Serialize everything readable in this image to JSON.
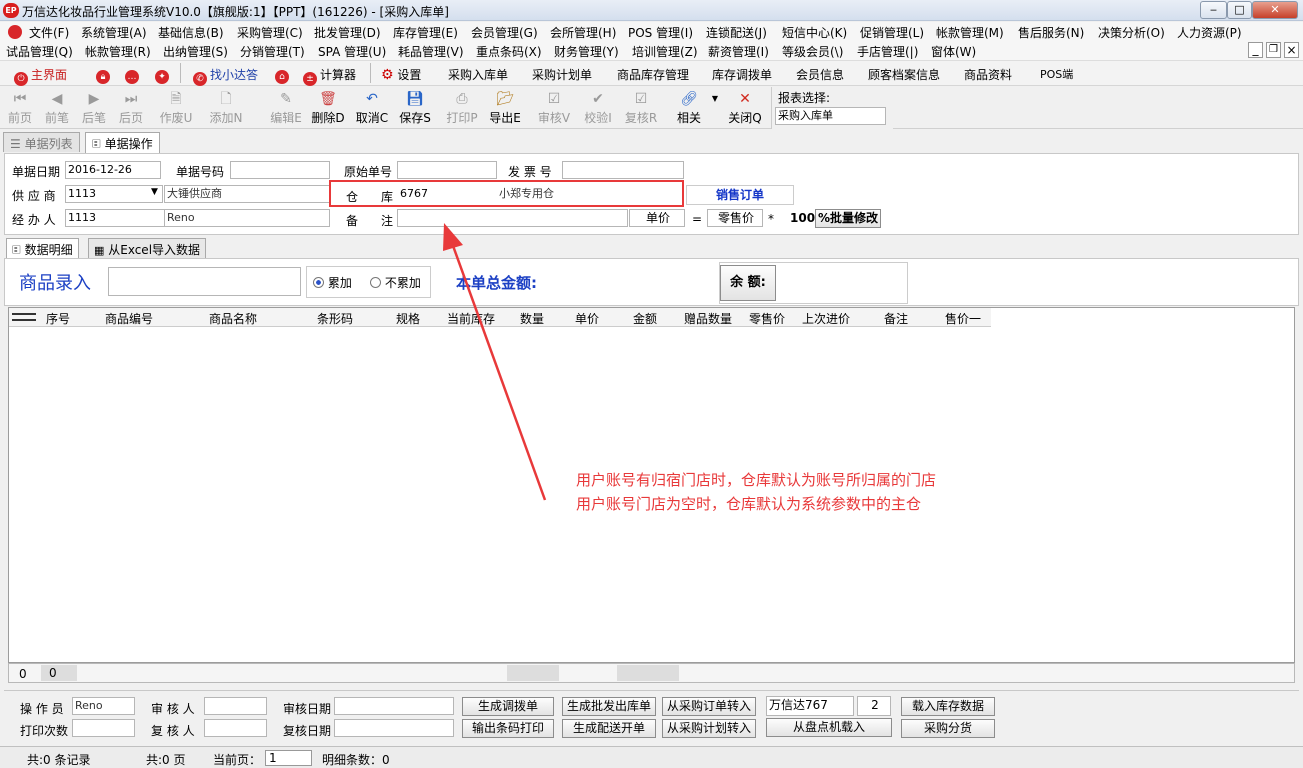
{
  "window": {
    "logo_text": "EP",
    "title": "万信达化妆品行业管理系统V10.0【旗舰版:1】【PPT】(161226) - [采购入库单]",
    "min": "‒",
    "max": "□",
    "close": "✕",
    "child_min": "_",
    "child_restore": "❐",
    "child_close": "×"
  },
  "menu_row1": [
    "文件(F)",
    "系统管理(A)",
    "基础信息(B)",
    "采购管理(C)",
    "批发管理(D)",
    "库存管理(E)",
    "会员管理(G)",
    "会所管理(H)",
    "POS 管理(I)",
    "连锁配送(J)",
    "短信中心(K)",
    "促销管理(L)",
    "帐款管理(M)",
    "售后服务(N)",
    "决策分析(O)",
    "人力资源(P)"
  ],
  "menu_row2": [
    "试品管理(Q)",
    "帐款管理(R)",
    "出纳管理(S)",
    "分销管理(T)",
    "SPA 管理(U)",
    "耗品管理(V)",
    "重点条码(X)",
    "财务管理(Y)",
    "培训管理(Z)",
    "薪资管理(I)",
    "等级会员(\\)",
    "手店管理(|)",
    "窗体(W)"
  ],
  "quickbar": {
    "home": "主界面",
    "find_helper": "找小达答",
    "calculator": "计算器",
    "settings": "设置",
    "links": [
      "采购入库单",
      "采购计划单",
      "商品库存管理",
      "库存调拨单",
      "会员信息",
      "顾客档案信息",
      "商品资料",
      "POS端"
    ]
  },
  "toolbar": {
    "buttons": [
      "前页",
      "前笔",
      "后笔",
      "后页",
      "作废U",
      "添加N",
      "编辑E",
      "删除D",
      "取消C",
      "保存S",
      "打印P",
      "导出E",
      "审核V",
      "校验I",
      "复核R",
      "相关",
      "关闭Q"
    ],
    "report_label": "报表选择:",
    "report_value": "采购入库单"
  },
  "tabs": {
    "list": "单据列表",
    "operate": "单据操作"
  },
  "form": {
    "date_label": "单据日期",
    "date_value": "2016-12-26",
    "docno_label": "单据号码",
    "docno_value": "",
    "orig_label": "原始单号",
    "orig_value": "",
    "invoice_label": "发 票 号",
    "invoice_value": "",
    "supplier_label": "供 应 商",
    "supplier_code": "1113",
    "supplier_name": "大锤供应商",
    "warehouse_label_1": "仓",
    "warehouse_label_2": "库",
    "warehouse_code": "6767",
    "warehouse_name": "小郑专用仓",
    "sales_order": "销售订单",
    "handler_label": "经 办 人",
    "handler_code": "1113",
    "handler_name": "Reno",
    "remark_label_1": "备",
    "remark_label_2": "注",
    "remark_value": "",
    "price_label": "单价",
    "equals": "=",
    "retail_label": "零售价",
    "times": "*",
    "percent_value": "100",
    "batch_button": "%批量修改"
  },
  "subtabs": {
    "detail": "数据明细",
    "excel": "从Excel导入数据"
  },
  "entry": {
    "label": "商品录入",
    "accumulate": "累加",
    "no_accumulate": "不累加",
    "total_label": "本单总金额:",
    "balance_label": "余 额:"
  },
  "grid": {
    "columns": [
      "序号",
      "商品编号",
      "商品名称",
      "条形码",
      "规格",
      "当前库存",
      "数量",
      "单价",
      "金额",
      "赠品数量",
      "零售价",
      "上次进价",
      "备注",
      "售价一"
    ],
    "footer_count": "0",
    "footer_value": "0"
  },
  "annotation": {
    "line1": "用户账号有归宿门店时，仓库默认为账号所归属的门店",
    "line2": "用户账号门店为空时，仓库默认为系统参数中的主仓"
  },
  "bottom": {
    "operator_label": "操 作 员",
    "operator_value": "Reno",
    "auditor_label": "审 核 人",
    "auditor_value": "",
    "audit_date_label": "审核日期",
    "audit_date_value": "",
    "print_count_label": "打印次数",
    "print_count_value": "",
    "reviewer_label": "复 核 人",
    "reviewer_value": "",
    "review_date_label": "复核日期",
    "review_date_value": "",
    "btn_transfer": "生成调拨单",
    "btn_wholesale": "生成批发出库单",
    "btn_from_po": "从采购订单转入",
    "btn_print_barcode": "输出条码打印",
    "btn_dispatch": "生成配送开单",
    "btn_from_plan": "从采购计划转入",
    "store_value": "万信达767",
    "store_num": "2",
    "btn_load_stock": "载入库存数据",
    "btn_from_inventory": "从盘点机载入",
    "btn_distribute": "采购分货"
  },
  "status": {
    "records": "共:0 条记录",
    "pages": "共:0 页",
    "current_page_label": "当前页：",
    "current_page": "1",
    "detail_count": "明细条数：0"
  }
}
